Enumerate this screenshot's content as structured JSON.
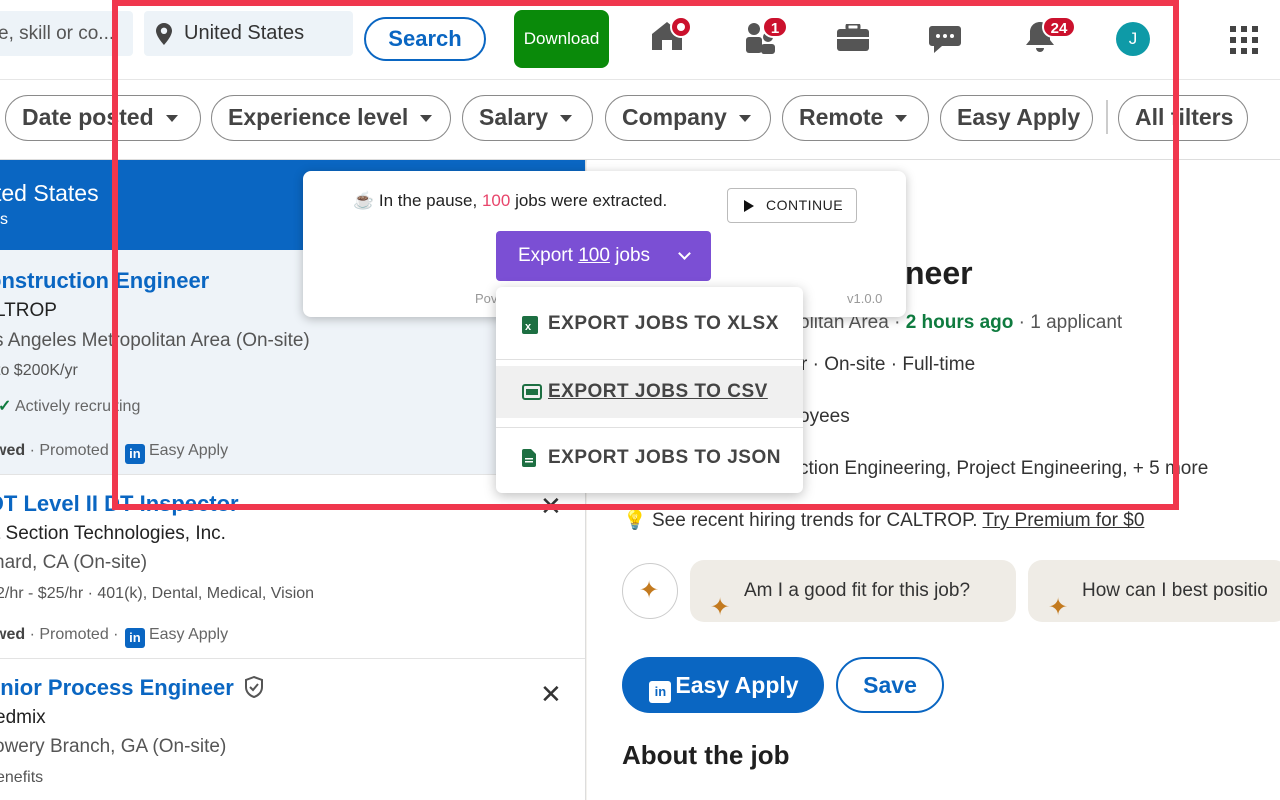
{
  "header": {
    "search_keyword_placeholder": "Title, skill or co...",
    "search_keyword_visible": "e, skill or co...",
    "location": "United States",
    "search_label": "Search",
    "download_label": "Download",
    "badges": {
      "home": "",
      "network": "1",
      "notifications": "24"
    },
    "avatar_initial": "J"
  },
  "filters": [
    "Date posted",
    "Experience level",
    "Salary",
    "Company",
    "Remote",
    "Easy Apply",
    "All filters"
  ],
  "list": {
    "header_title": "ted States",
    "header_sub": "lts",
    "jobs": [
      {
        "title": "onstruction Engineer",
        "company": "LTROP",
        "location": "s Angeles Metropolitan Area (On-site)",
        "salary": "to $200K/yr",
        "recruiting": "Actively recruiting",
        "viewed": "wed",
        "promoted": "Promoted",
        "easy_apply": "Easy Apply"
      },
      {
        "title": "DT Level II DT Inspector",
        "company": "t Section Technologies, Inc.",
        "location": "nard, CA (On-site)",
        "salary": "2/hr - $25/hr · 401(k), Dental, Medical, Vision",
        "viewed": "wed",
        "promoted": "Promoted",
        "easy_apply": "Easy Apply"
      },
      {
        "title": "enior Process Engineer",
        "company": "edmix",
        "location": "owery Branch, GA (On-site)",
        "salary": "enefits"
      }
    ]
  },
  "detail": {
    "title_fragment": "neer",
    "line1_left": "olitan Area",
    "posted": "2 hours ago",
    "applicants": "· 1 applicant",
    "line2": "r · On-site · Full-time",
    "line3": "oyees",
    "line4": "ction Engineering, Project Engineering, + 5 more",
    "premium_text": "See recent hiring trends for CALTROP.",
    "premium_link": "Try Premium for $0",
    "ai_q1": "Am I a good fit for this job?",
    "ai_q2": "How can I best positio",
    "easy_apply": "Easy Apply",
    "save": "Save",
    "about": "About the job"
  },
  "popup": {
    "msg_prefix": "In the pause,",
    "count": "100",
    "msg_suffix": "jobs were extracted.",
    "continue_label": "CONTINUE",
    "export_prefix": "Export",
    "export_count": "100",
    "export_suffix": "jobs",
    "powered": "Pov",
    "version": "v1.0.0",
    "menu": [
      "EXPORT JOBS TO XLSX",
      "EXPORT JOBS TO CSV",
      "EXPORT JOBS TO JSON"
    ]
  },
  "colors": {
    "brand_blue": "#0a66c2",
    "download_green": "#0a8a0a",
    "export_purple": "#7b4fd4",
    "highlight_red": "#f0374d",
    "posted_green": "#0f7b3f"
  }
}
